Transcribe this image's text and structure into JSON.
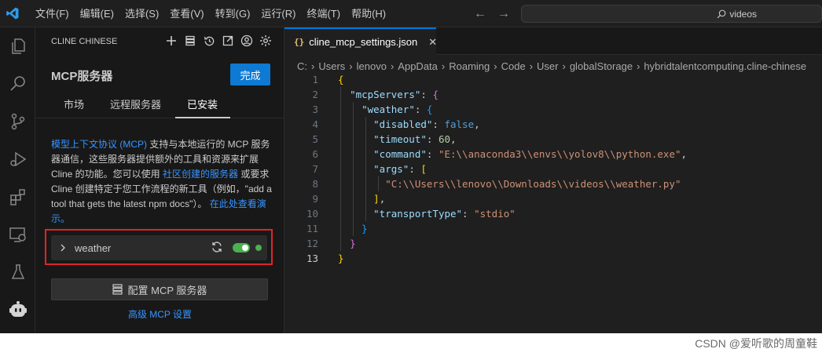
{
  "menu": [
    "文件(F)",
    "编辑(E)",
    "选择(S)",
    "查看(V)",
    "转到(G)",
    "运行(R)",
    "终端(T)",
    "帮助(H)"
  ],
  "search": {
    "value": "videos"
  },
  "sidebar": {
    "header": "CLINE CHINESE",
    "title": "MCP服务器",
    "done_label": "完成",
    "tabs": [
      "市场",
      "远程服务器",
      "已安装"
    ],
    "active_tab": "已安装",
    "description": {
      "link1": "模型上下文协议 (MCP)",
      "text1": " 支持与本地运行的 MCP 服务器通信，这些服务器提供额外的工具和资源来扩展 Cline 的功能。您可以使用 ",
      "link2": "社区创建的服务器",
      "text2": " 或要求 Cline 创建特定于您工作流程的新工具（例如，\"add a tool that gets the latest npm docs\"）。 ",
      "link3": "在此处查看演示。"
    },
    "server": {
      "name": "weather",
      "enabled": true
    },
    "config_button": "配置 MCP 服务器",
    "advanced_link": "高级 MCP 设置"
  },
  "editor": {
    "tab_label": "cline_mcp_settings.json",
    "json_icon": "{}",
    "breadcrumb": [
      "C:",
      "Users",
      "lenovo",
      "AppData",
      "Roaming",
      "Code",
      "User",
      "globalStorage",
      "hybridtalentcomputing.cline-chinese"
    ],
    "line_numbers": [
      "1",
      "2",
      "3",
      "4",
      "5",
      "6",
      "7",
      "8",
      "9",
      "10",
      "11",
      "12",
      "13"
    ],
    "code": {
      "key_mcpServers": "\"mcpServers\"",
      "key_weather": "\"weather\"",
      "key_disabled": "\"disabled\"",
      "val_disabled": "false",
      "key_timeout": "\"timeout\"",
      "val_timeout": "60",
      "key_command": "\"command\"",
      "val_command": "\"E:\\\\anaconda3\\\\envs\\\\yolov8\\\\python.exe\"",
      "key_args": "\"args\"",
      "val_arg0": "\"C:\\\\Users\\\\lenovo\\\\Downloads\\\\videos\\\\weather.py\"",
      "key_transportType": "\"transportType\"",
      "val_transportType": "\"stdio\""
    }
  },
  "watermark": "CSDN @爱听歌的周童鞋"
}
